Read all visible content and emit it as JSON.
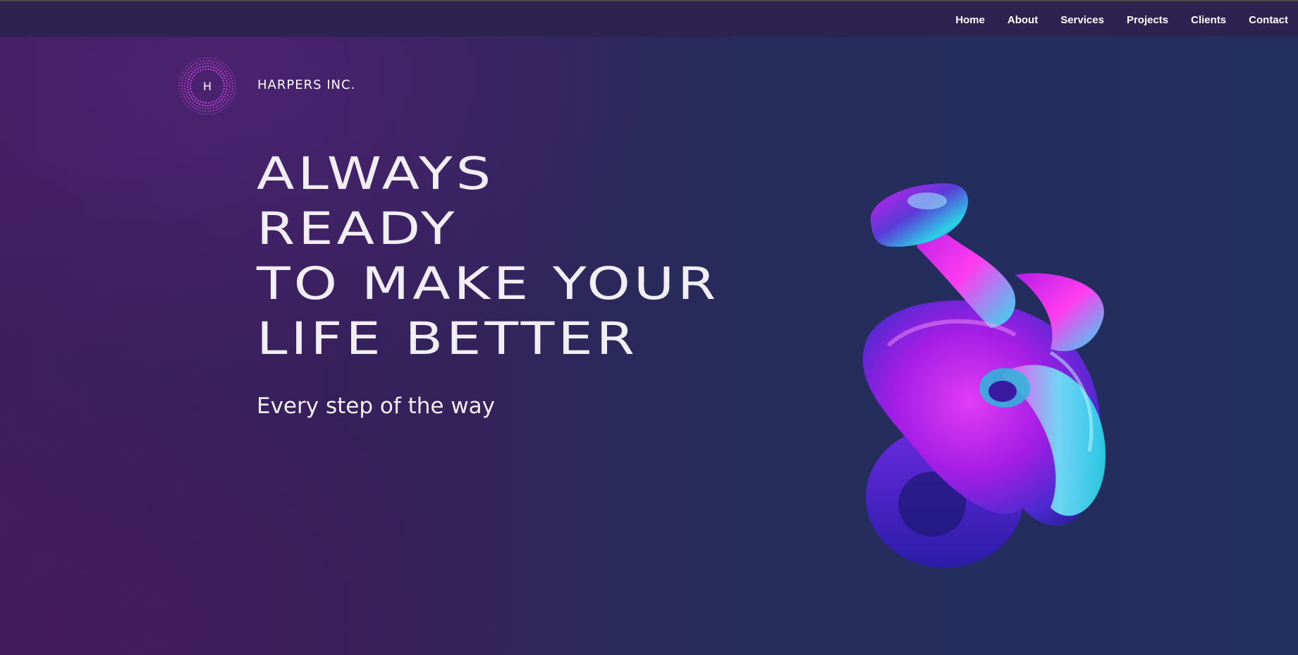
{
  "nav": {
    "items": [
      {
        "label": "Home"
      },
      {
        "label": "About"
      },
      {
        "label": "Services"
      },
      {
        "label": "Projects"
      },
      {
        "label": "Clients"
      },
      {
        "label": "Contact"
      }
    ]
  },
  "logo": {
    "letter": "H",
    "icon": "dotted-ring-logo-icon"
  },
  "brand": {
    "name": "HARPERS INC."
  },
  "hero": {
    "headline_lines": [
      "ALWAYS",
      "READY",
      "TO MAKE YOUR",
      "LIFE BETTER"
    ],
    "subtitle": "Every step of the way",
    "image": "iridescent-3d-blob-illustration"
  },
  "colors": {
    "background_left": "#3e1d5e",
    "background_right": "#223060",
    "topbar": "#2c2350",
    "text": "#f1eef6",
    "accent_magenta": "#c026d3",
    "accent_cyan": "#22d3ee"
  }
}
